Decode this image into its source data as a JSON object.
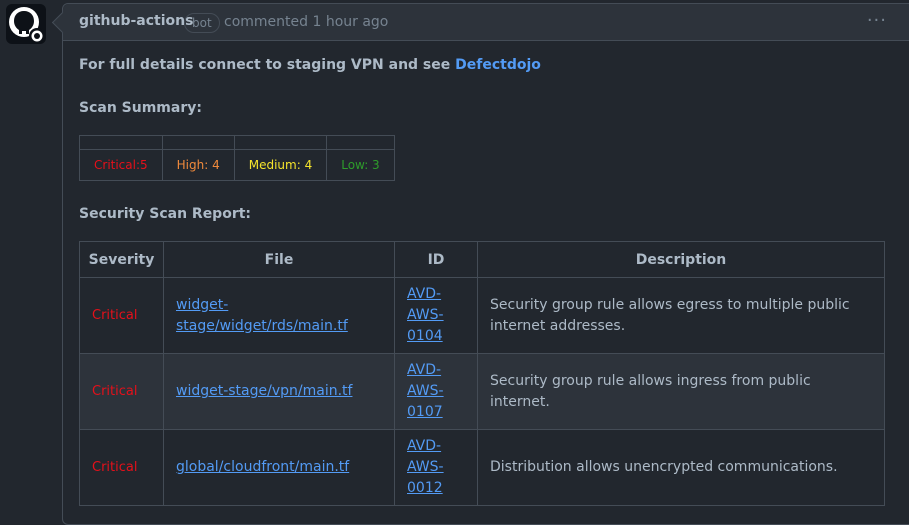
{
  "comment": {
    "author": "github-actions",
    "badge": "bot",
    "meta": "commented 1 hour ago",
    "menu_label": "···"
  },
  "intro": {
    "text": "For full details connect to staging VPN and see",
    "link": "Defectdojo"
  },
  "summary": {
    "heading": "Scan Summary:",
    "cells": [
      "Critical:5",
      "High: 4",
      "Medium: 4",
      "Low: 3"
    ]
  },
  "report": {
    "heading": "Security Scan Report:",
    "columns": [
      "Severity",
      "File",
      "ID",
      "Description"
    ],
    "rows": [
      {
        "severity": "Critical",
        "file": "widget-stage/widget/rds/main.tf",
        "id": "AVD-AWS-0104",
        "description": "Security group rule allows egress to multiple public internet addresses."
      },
      {
        "severity": "Critical",
        "file": "widget-stage/vpn/main.tf",
        "id": "AVD-AWS-0107",
        "description": "Security group rule allows ingress from public internet."
      },
      {
        "severity": "Critical",
        "file": "global/cloudfront/main.tf",
        "id": "AVD-AWS-0012",
        "description": "Distribution allows unencrypted communications."
      }
    ]
  },
  "colors": {
    "background": "#22272e",
    "link": "#539bf5",
    "critical": "#e5101a",
    "high": "#f08a3c",
    "medium": "#f5e42c",
    "low": "#2e9c2b"
  },
  "icons": {
    "avatar": "github-octocat-icon",
    "avatar_badge": "github-app-badge-icon"
  }
}
